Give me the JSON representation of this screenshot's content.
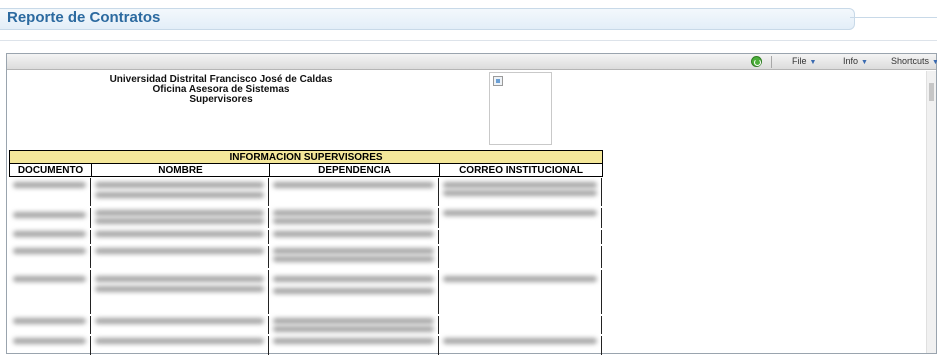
{
  "page": {
    "title": "Reporte de Contratos"
  },
  "toolbar": {
    "refresh_icon": "refresh-icon",
    "menus": [
      {
        "label": "File"
      },
      {
        "label": "Info"
      },
      {
        "label": "Shortcuts"
      }
    ]
  },
  "report": {
    "org_lines": [
      "Universidad Distrital Francisco José de Caldas",
      "Oficina Asesora de Sistemas",
      "Supervisores"
    ],
    "section_title": "INFORMACION SUPERVISORES",
    "columns": [
      "DOCUMENTO",
      "NOMBRE",
      "DEPENDENCIA",
      "CORREO INSTITUCIONAL"
    ],
    "row_count": 7
  },
  "colors": {
    "title": "#2c6aa0",
    "section_bg": "#f4e79a"
  }
}
